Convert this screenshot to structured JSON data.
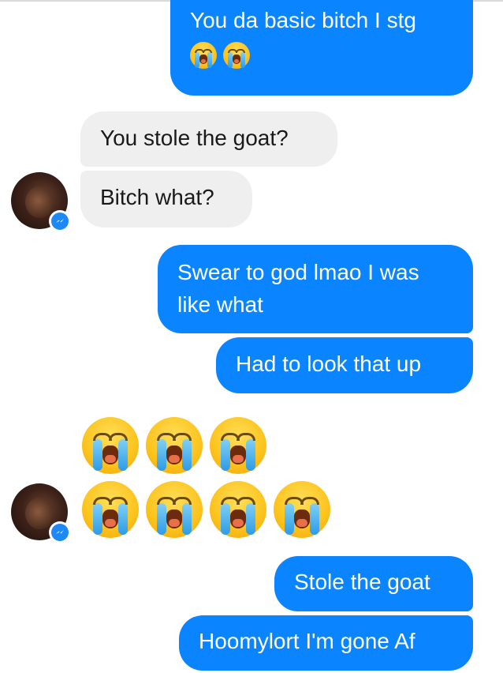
{
  "conversation": {
    "messages": [
      {
        "direction": "outgoing",
        "text": "You da basic bitch I stg",
        "emoji": "loudly-crying-face",
        "emoji_count": 2
      },
      {
        "direction": "incoming",
        "text": "You stole the goat?"
      },
      {
        "direction": "incoming",
        "text": "Bitch what?"
      },
      {
        "direction": "outgoing",
        "text": "Swear to god lmao I was like what"
      },
      {
        "direction": "outgoing",
        "text": "Had to look that up"
      },
      {
        "direction": "incoming",
        "emoji": "loudly-crying-face",
        "emoji_count": 7
      },
      {
        "direction": "outgoing",
        "text": "Stole the goat"
      },
      {
        "direction": "outgoing",
        "text": "Hoomylort I'm gone Af"
      }
    ]
  },
  "colors": {
    "outgoing_bubble": "#0a84ff",
    "incoming_bubble": "#efefef",
    "messenger_badge": "#1e88f5"
  },
  "icons": {
    "badge": "messenger-icon",
    "emoji": "loudly-crying-face"
  }
}
